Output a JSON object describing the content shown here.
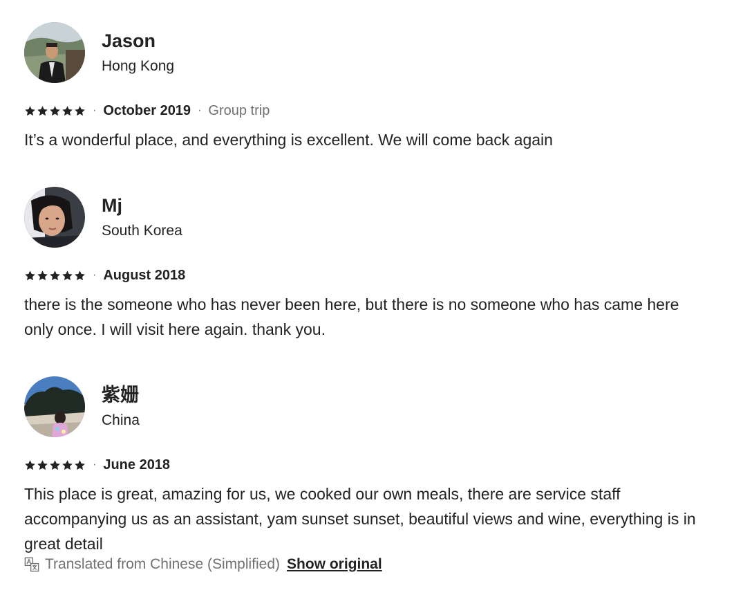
{
  "reviews": [
    {
      "name": "Jason",
      "location": "Hong Kong",
      "rating": 5,
      "date": "October 2019",
      "trip_type": "Group trip",
      "text": "It’s a wonderful place, and everything is excellent. We will come back again"
    },
    {
      "name": "Mj",
      "location": "South Korea",
      "rating": 5,
      "date": "August 2018",
      "text": "there is the someone who has never been here, but there is no someone who has came here only once. I will visit here again. thank you."
    },
    {
      "name": "紫姗",
      "location": "China",
      "rating": 5,
      "date": "June 2018",
      "text": "This place is great, amazing for us, we cooked our own meals, there are service staff accompanying us as an assistant, yam sunset sunset, beautiful views and wine, everything is in great detail"
    }
  ],
  "translation": {
    "note": "Translated from Chinese (Simplified)",
    "show_original_label": "Show original"
  },
  "colors": {
    "text_primary": "#222222",
    "text_secondary": "#717171",
    "star": "#222222"
  },
  "icons": {
    "rating": "star-icon",
    "translation": "translate-icon"
  }
}
